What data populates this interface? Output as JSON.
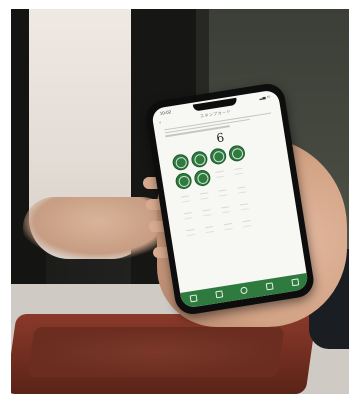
{
  "phone": {
    "status_time": "10:02",
    "status_icons": "▂▄ ▭",
    "screen_title": "スタンプカード",
    "back_icon": "chevron-left-icon",
    "stamp_count": "6",
    "stamps_collected": 6,
    "stamp_slots_total": 20,
    "tabs": [
      {
        "icon": "home-icon"
      },
      {
        "icon": "ticket-icon"
      },
      {
        "icon": "stamp-icon"
      },
      {
        "icon": "calendar-icon"
      },
      {
        "icon": "menu-icon"
      }
    ]
  },
  "colors": {
    "accent_green": "#2f7a3e",
    "tray_lacquer": "#7a3324"
  }
}
